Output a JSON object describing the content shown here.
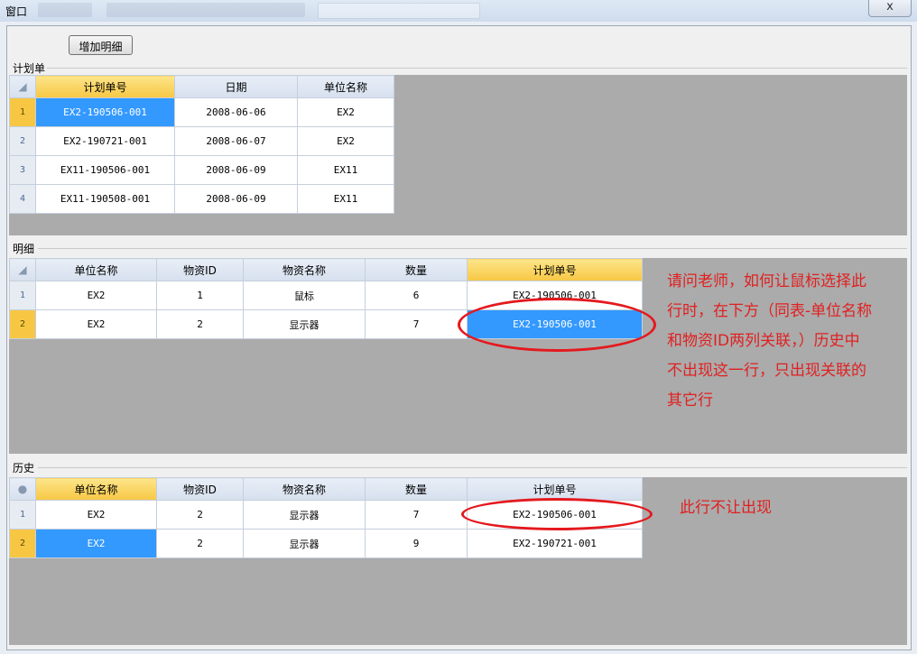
{
  "window": {
    "title": "窗口",
    "close": "x"
  },
  "toolbar": {
    "add_detail_label": "增加明细"
  },
  "plan": {
    "label": "计划单",
    "columns": [
      "计划单号",
      "日期",
      "单位名称"
    ],
    "rows": [
      {
        "num": "1",
        "cells": [
          "EX2-190506-001",
          "2008-06-06",
          "EX2"
        ]
      },
      {
        "num": "2",
        "cells": [
          "EX2-190721-001",
          "2008-06-07",
          "EX2"
        ]
      },
      {
        "num": "3",
        "cells": [
          "EX11-190506-001",
          "2008-06-09",
          "EX11"
        ]
      },
      {
        "num": "4",
        "cells": [
          "EX11-190508-001",
          "2008-06-09",
          "EX11"
        ]
      }
    ]
  },
  "detail": {
    "label": "明细",
    "columns": [
      "单位名称",
      "物资ID",
      "物资名称",
      "数量",
      "计划单号"
    ],
    "rows": [
      {
        "num": "1",
        "cells": [
          "EX2",
          "1",
          "鼠标",
          "6",
          "EX2-190506-001"
        ]
      },
      {
        "num": "2",
        "cells": [
          "EX2",
          "2",
          "显示器",
          "7",
          "EX2-190506-001"
        ]
      }
    ]
  },
  "history": {
    "label": "历史",
    "columns": [
      "单位名称",
      "物资ID",
      "物资名称",
      "数量",
      "计划单号"
    ],
    "rows": [
      {
        "num": "1",
        "cells": [
          "EX2",
          "2",
          "显示器",
          "7",
          "EX2-190506-001"
        ]
      },
      {
        "num": "2",
        "cells": [
          "EX2",
          "2",
          "显示器",
          "9",
          "EX2-190721-001"
        ]
      }
    ]
  },
  "annotations": {
    "question": [
      "请问老师，如何让鼠标选择此",
      "行时，在下方（同表-单位名称",
      "和物资ID两列关联，）历史中",
      "不出现这一行，只出现关联的",
      "其它行"
    ],
    "history_note": "此行不让出现"
  },
  "colors": {
    "selected": "#3399ff",
    "active_header": "#f7c744",
    "annotation": "#e02020",
    "grid_background": "#ababab"
  }
}
